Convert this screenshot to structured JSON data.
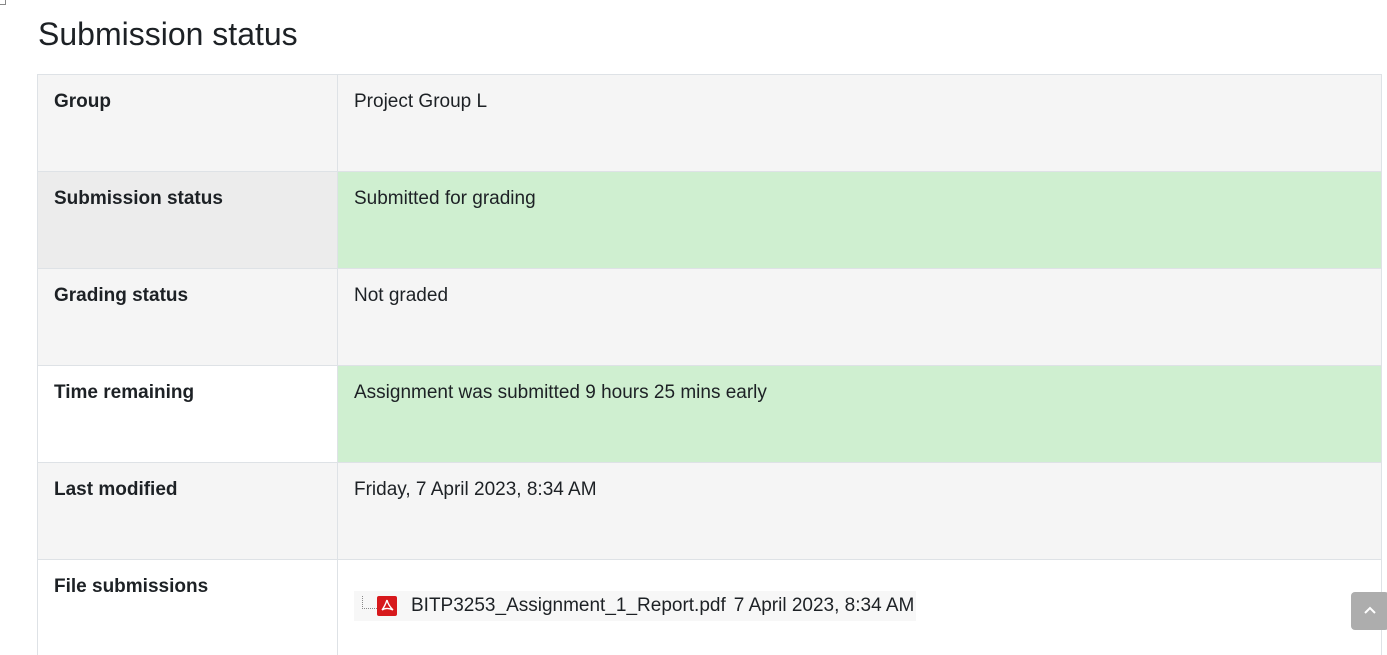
{
  "page": {
    "title": "Submission status"
  },
  "rows": [
    {
      "label": "Group",
      "value": "Project Group L"
    },
    {
      "label": "Submission status",
      "value": "Submitted for grading"
    },
    {
      "label": "Grading status",
      "value": "Not graded"
    },
    {
      "label": "Time remaining",
      "value": "Assignment was submitted 9 hours 25 mins early"
    },
    {
      "label": "Last modified",
      "value": "Friday, 7 April 2023, 8:34 AM"
    },
    {
      "label": "File submissions",
      "value": ""
    }
  ],
  "file": {
    "name": "BITP3253_Assignment_1_Report.pdf",
    "date": "7 April 2023, 8:34 AM",
    "icon": "pdf-icon"
  },
  "colors": {
    "success_bg": "#cfefd0",
    "row_gray": "#f5f5f5",
    "pdf_red": "#d7191c"
  },
  "icons": {
    "scroll_top": "chevron-up-icon"
  }
}
